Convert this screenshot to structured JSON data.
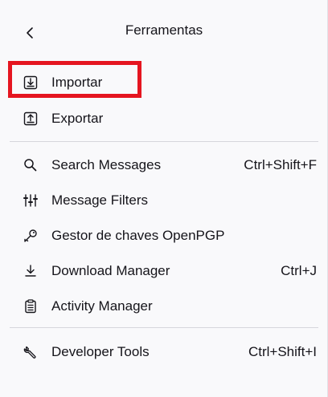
{
  "header": {
    "title": "Ferramentas",
    "back_icon": "chevron-left-icon"
  },
  "menu": {
    "items": [
      {
        "id": "import",
        "label": "Importar",
        "shortcut": "",
        "icon": "import-icon"
      },
      {
        "id": "export",
        "label": "Exportar",
        "shortcut": "",
        "icon": "export-icon"
      },
      {
        "id": "search",
        "label": "Search Messages",
        "shortcut": "Ctrl+Shift+F",
        "icon": "search-icon"
      },
      {
        "id": "filters",
        "label": "Message Filters",
        "shortcut": "",
        "icon": "filters-icon"
      },
      {
        "id": "openpgp",
        "label": "Gestor de chaves OpenPGP",
        "shortcut": "",
        "icon": "key-icon"
      },
      {
        "id": "download",
        "label": "Download Manager",
        "shortcut": "Ctrl+J",
        "icon": "download-icon"
      },
      {
        "id": "activity",
        "label": "Activity Manager",
        "shortcut": "",
        "icon": "clipboard-icon"
      },
      {
        "id": "devtools",
        "label": "Developer Tools",
        "shortcut": "Ctrl+Shift+I",
        "icon": "wrench-icon"
      }
    ]
  },
  "annotation": {
    "highlight_color": "#e51520"
  }
}
